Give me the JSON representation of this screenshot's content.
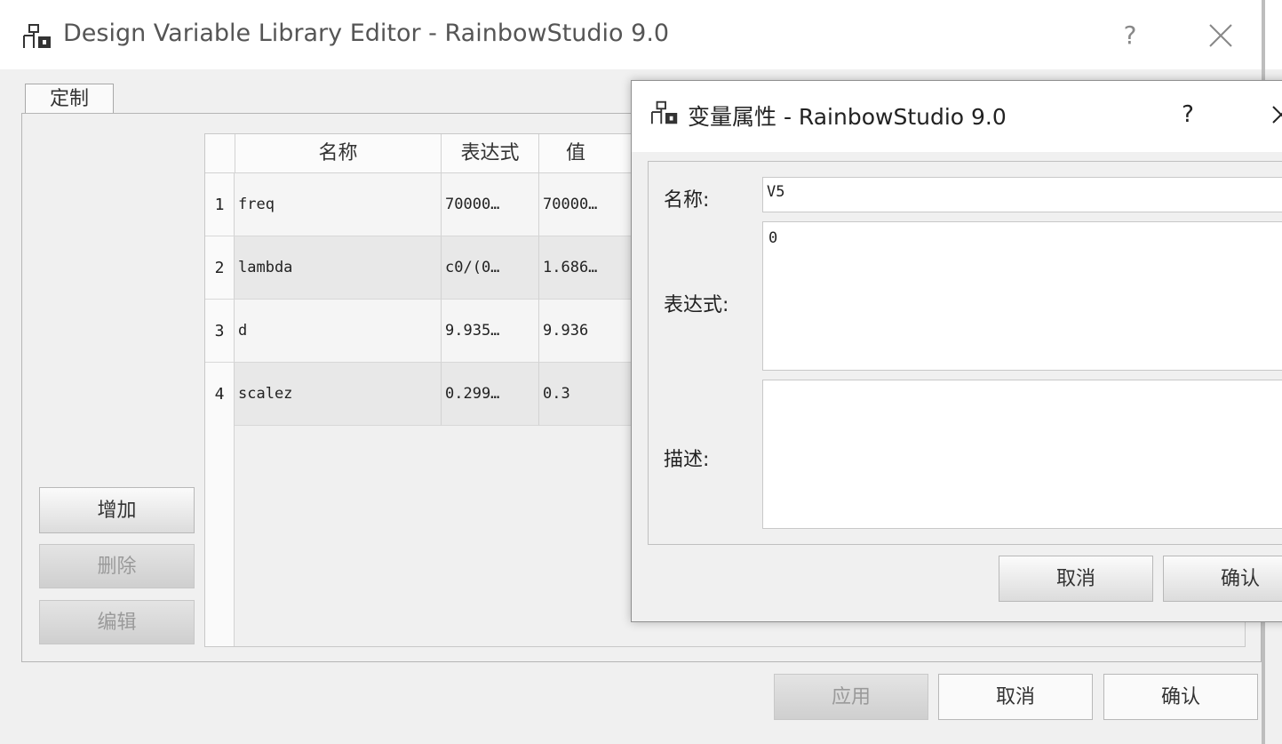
{
  "main_window": {
    "title": "Design Variable Library Editor - RainbowStudio 9.0",
    "help_label": "?",
    "tab_label": "定制",
    "table": {
      "headers": [
        "名称",
        "表达式",
        "值"
      ],
      "rows": [
        {
          "num": "1",
          "name": "freq",
          "expression": "70000…",
          "value": "70000…"
        },
        {
          "num": "2",
          "name": "lambda",
          "expression": "c0/(0…",
          "value": "1.686…"
        },
        {
          "num": "3",
          "name": "d",
          "expression": "9.935…",
          "value": "9.936"
        },
        {
          "num": "4",
          "name": "scalez",
          "expression": "0.299…",
          "value": "0.3"
        }
      ]
    },
    "side_buttons": {
      "add": "增加",
      "delete": "删除",
      "edit": "编辑"
    },
    "footer_buttons": {
      "apply": "应用",
      "cancel": "取消",
      "ok": "确认"
    }
  },
  "dialog": {
    "title": "变量属性 - RainbowStudio 9.0",
    "help_label": "?",
    "name_label": "名称:",
    "name_value": "V5",
    "expression_label": "表达式:",
    "expression_value": "0",
    "description_label": "描述:",
    "description_value": "",
    "cancel_label": "取消",
    "ok_label": "确认"
  },
  "icons": {
    "window_icon": "hierarchy-icon",
    "close_icon": "close-icon"
  }
}
